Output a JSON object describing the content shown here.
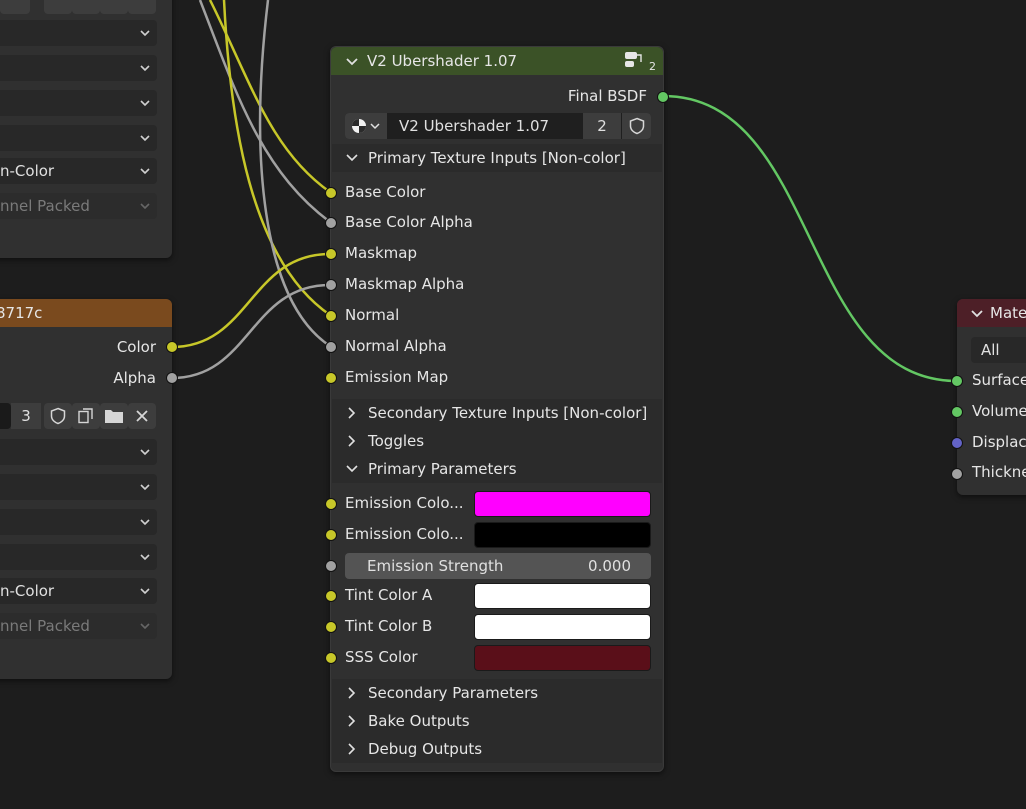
{
  "left_top_node": {
    "dropdown_4_value": "n-Color",
    "dropdown_5_value": "nnel Packed"
  },
  "left_bottom_node": {
    "title": "8717c",
    "outputs": {
      "color": "Color",
      "alpha": "Alpha"
    },
    "user_count": "3",
    "dropdown_4_value": "n-Color",
    "dropdown_5_value": "nnel Packed"
  },
  "ubershader": {
    "title": "V2 Ubershader 1.07",
    "output_label": "Final BSDF",
    "group_name": "V2 Ubershader 1.07",
    "user_count": "2",
    "header_badge": "2",
    "panels": {
      "primary_textures": "Primary Texture Inputs [Non-color]",
      "secondary_textures": "Secondary Texture Inputs [Non-color]",
      "toggles": "Toggles",
      "primary_params": "Primary Parameters",
      "secondary_params": "Secondary Parameters",
      "bake_outputs": "Bake Outputs",
      "debug_outputs": "Debug Outputs"
    },
    "texture_inputs": [
      "Base Color",
      "Base Color Alpha",
      "Maskmap",
      "Maskmap Alpha",
      "Normal",
      "Normal Alpha",
      "Emission Map"
    ],
    "params": {
      "emission_color_a": "Emission Colo...",
      "emission_color_b": "Emission Colo...",
      "emission_strength_label": "Emission Strength",
      "emission_strength_value": "0.000",
      "tint_a": "Tint Color A",
      "tint_b": "Tint Color B",
      "sss": "SSS Color"
    },
    "swatch_colors": {
      "emission_a": "#ff00ff",
      "emission_b": "#000000",
      "tint_a": "#ffffff",
      "tint_b": "#ffffff",
      "sss": "#5a0f19"
    }
  },
  "material_output": {
    "title": "Mate",
    "target": "All",
    "inputs": [
      "Surface",
      "Volume",
      "Displac",
      "Thickne"
    ]
  },
  "colors": {
    "group_header": "#3b5227",
    "texture_header": "#7a4a1e",
    "output_header": "#4d1f27",
    "wire_yellow": "#c7c729",
    "wire_gray": "#a1a1a1",
    "wire_green": "#63c763"
  }
}
